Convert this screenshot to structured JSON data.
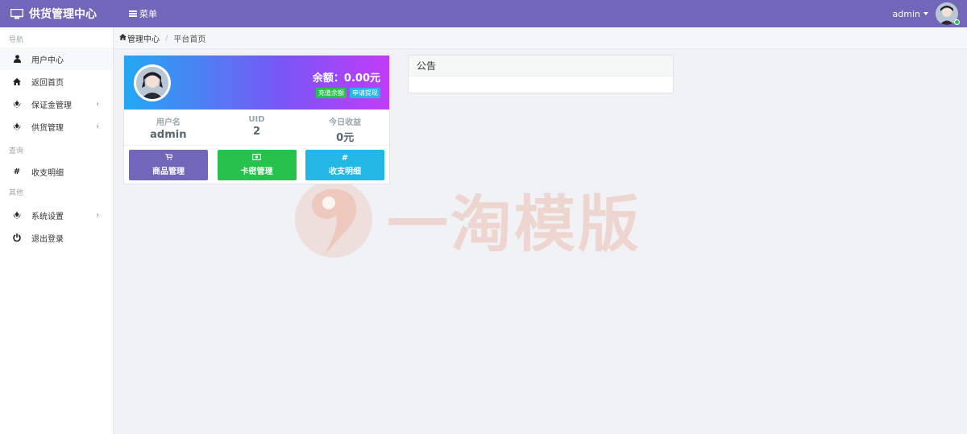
{
  "app": {
    "title": "供货管理中心"
  },
  "topbar": {
    "menu_label": "菜单",
    "user_name": "admin"
  },
  "sidebar": {
    "sections": [
      {
        "header": "导航",
        "items": [
          {
            "label": "用户中心",
            "icon": "user-icon"
          },
          {
            "label": "返回首页",
            "icon": "home-icon"
          },
          {
            "label": "保证金管理",
            "icon": "rebel-icon",
            "has_submenu": true
          },
          {
            "label": "供货管理",
            "icon": "rebel-icon",
            "has_submenu": true
          }
        ]
      },
      {
        "header": "查询",
        "items": [
          {
            "label": "收支明细",
            "icon": "hashtag-icon"
          }
        ]
      },
      {
        "header": "其他",
        "items": [
          {
            "label": "系统设置",
            "icon": "rebel-icon",
            "has_submenu": true
          },
          {
            "label": "退出登录",
            "icon": "power-icon"
          }
        ]
      }
    ]
  },
  "breadcrumb": {
    "home": "管理中心",
    "current": "平台首页"
  },
  "user_card": {
    "balance_label": "余额：",
    "balance_value": "0.00元",
    "recharge_label": "充值余额",
    "withdraw_label": "申请提现",
    "stats": [
      {
        "label": "用户名",
        "value": "admin"
      },
      {
        "label": "UID",
        "value": "2"
      },
      {
        "label": "今日收益",
        "value": "0元"
      }
    ],
    "actions": [
      {
        "label": "商品管理",
        "icon": "cart-icon",
        "color": "#7266ba"
      },
      {
        "label": "卡密管理",
        "icon": "money-icon",
        "color": "#27c24c"
      },
      {
        "label": "收支明细",
        "icon": "hashtag-icon",
        "color": "#23b7e5"
      }
    ]
  },
  "notice": {
    "title": "公告"
  },
  "watermark": {
    "text": "一淘模版"
  },
  "colors": {
    "primary": "#7266ba",
    "success": "#27c24c",
    "info": "#23b7e5"
  }
}
